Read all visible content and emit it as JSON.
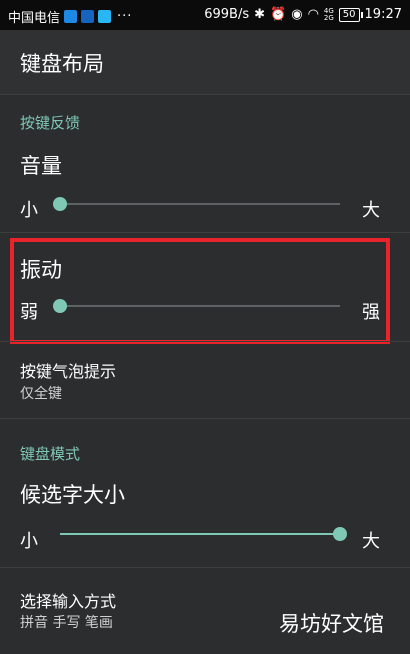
{
  "status_bar": {
    "carrier": "中国电信",
    "more": "···",
    "speed": "699B/s",
    "signal_top": "4G",
    "signal_bottom": "2G",
    "battery": "50",
    "time": "19:27",
    "app_icon_colors": [
      "#1e88e5",
      "#1565c0",
      "#29b6f6"
    ]
  },
  "app_bar": {
    "title": "键盘布局"
  },
  "sections": {
    "feedback": {
      "header": "按键反馈"
    },
    "mode": {
      "header": "键盘模式"
    }
  },
  "volume": {
    "title": "音量",
    "min_label": "小",
    "max_label": "大",
    "level": 0.0
  },
  "vibration": {
    "title": "振动",
    "min_label": "弱",
    "max_label": "强",
    "level": 0.0
  },
  "key_bubble": {
    "title": "按键气泡提示",
    "summary": "仅全键"
  },
  "candidate_size": {
    "title": "候选字大小",
    "min_label": "小",
    "max_label": "大",
    "level": 1.0
  },
  "input_method": {
    "title": "选择输入方式",
    "summary": "拼音 手写 笔画"
  },
  "watermark": "易坊好文馆",
  "colors": {
    "accent": "#7fc8b6",
    "highlight": "#e8242a",
    "background": "#2b2d2f"
  }
}
